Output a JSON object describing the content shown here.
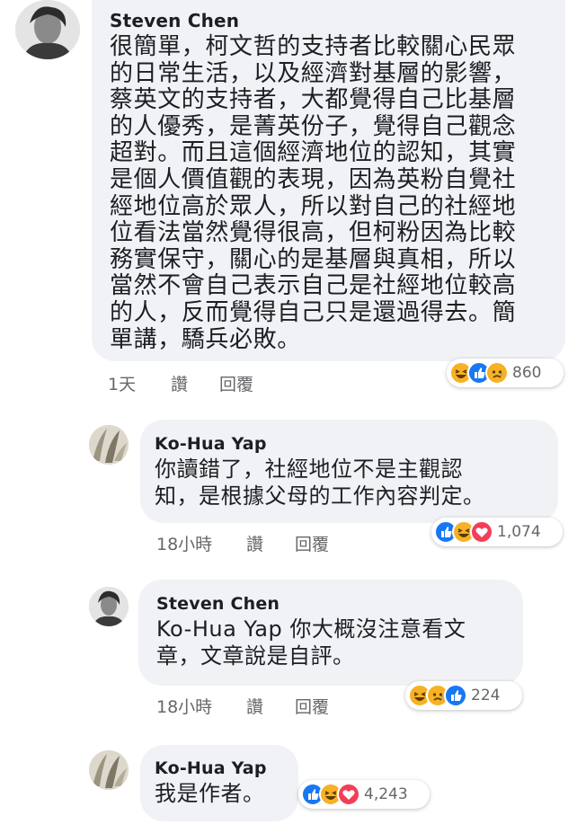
{
  "comments": [
    {
      "author": "Steven Chen",
      "text": "很簡單，柯文哲的支持者比較關心民眾\n的日常生活，以及經濟對基層的影響，\n蔡英文的支持者，大都覺得自己比基層\n的人優秀，是菁英份子，覺得自己觀念\n超對。而且這個經濟地位的認知，其實\n是個人價值觀的表現，因為英粉自覺社\n經地位高於眾人，所以對自己的社經地\n位看法當然覺得很高，但柯粉因為比較\n務實保守，關心的是基層與真相，所以\n當然不會自己表示自己是社經地位較高\n的人，反而覺得自己只是還過得去。簡\n單講，驕兵必敗。",
      "time": "1天",
      "like_label": "讚",
      "reply_label": "回覆",
      "reaction_count": "860",
      "reactions": [
        "haha",
        "like",
        "sad"
      ]
    },
    {
      "author": "Ko-Hua Yap",
      "text": "你讀錯了，社經地位不是主觀認\n知，是根據父母的工作內容判定。",
      "time": "18小時",
      "like_label": "讚",
      "reply_label": "回覆",
      "reaction_count": "1,074",
      "reactions": [
        "like",
        "haha",
        "love"
      ]
    },
    {
      "author": "Steven Chen",
      "text": "Ko-Hua Yap 你大概沒注意看文\n章，文章說是自評。",
      "time": "18小時",
      "like_label": "讚",
      "reply_label": "回覆",
      "reaction_count": "224",
      "reactions": [
        "haha",
        "sad",
        "like"
      ]
    },
    {
      "author": "Ko-Hua Yap",
      "text": "我是作者。",
      "time": "",
      "like_label": "",
      "reply_label": "",
      "reaction_count": "4,243",
      "reactions": [
        "like",
        "haha",
        "love"
      ]
    }
  ],
  "colors": {
    "bubble": "#f0f2f5",
    "meta_text": "#65676b",
    "like_blue": "#1877f2",
    "love_red": "#f33e58",
    "haha_yellow": "#f7b125"
  }
}
